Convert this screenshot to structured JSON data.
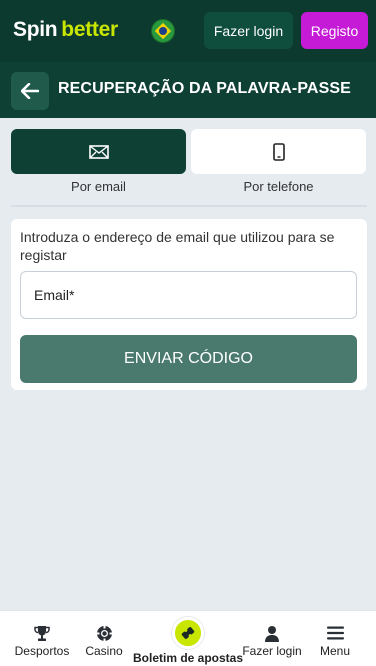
{
  "header": {
    "logo_part1": "Spin",
    "logo_part2": "better",
    "login_label": "Fazer login",
    "register_label": "Registo"
  },
  "subheader": {
    "title": "RECUPERAÇÃO DA PALAVRA-PASSE"
  },
  "tabs": [
    {
      "label": "Por email",
      "icon": "envelope-icon",
      "active": true
    },
    {
      "label": "Por telefone",
      "icon": "phone-icon",
      "active": false
    }
  ],
  "form": {
    "instructions": "Introduza o endereço de email que utilizou para se registar",
    "email_placeholder": "Email*",
    "submit_label": "ENVIAR CÓDIGO"
  },
  "bottom_nav": [
    {
      "label": "Desportos",
      "icon": "trophy-icon"
    },
    {
      "label": "Casino",
      "icon": "chip-icon"
    },
    {
      "label": "Boletim de apostas",
      "icon": "ticket-icon"
    },
    {
      "label": "Fazer login",
      "icon": "user-icon"
    },
    {
      "label": "Menu",
      "icon": "menu-icon"
    }
  ],
  "colors": {
    "header_bg": "#0c3a2f",
    "accent_lime": "#c8e600",
    "register_magenta": "#c51bd6",
    "submit_green": "#4a7a6d"
  }
}
